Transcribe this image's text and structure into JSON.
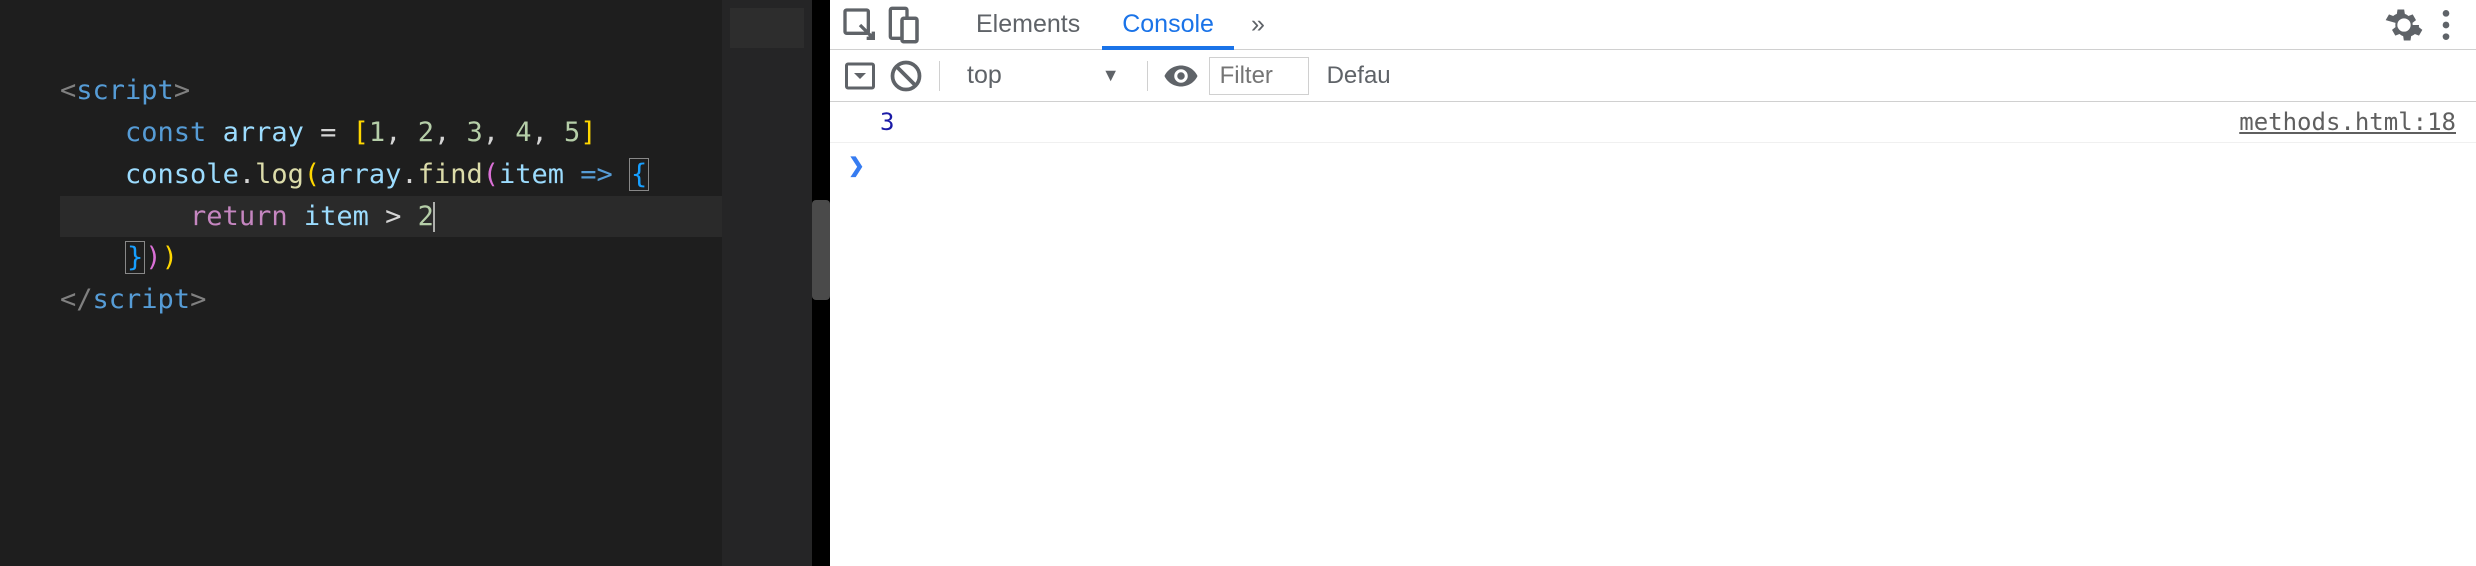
{
  "editor": {
    "code": {
      "line1_open_bracket": "<",
      "line1_tag": "script",
      "line1_close_bracket": ">",
      "line2_keyword": "const",
      "line2_var": "array",
      "line2_equals": " = ",
      "line2_bracket_open": "[",
      "line2_val1": "1",
      "line2_comma1": ", ",
      "line2_val2": "2",
      "line2_comma2": ", ",
      "line2_val3": "3",
      "line2_comma3": ", ",
      "line2_val4": "4",
      "line2_comma4": ", ",
      "line2_val5": "5",
      "line2_bracket_close": "]",
      "line3_obj": "console",
      "line3_dot1": ".",
      "line3_method1": "log",
      "line3_paren1": "(",
      "line3_var": "array",
      "line3_dot2": ".",
      "line3_method2": "find",
      "line3_paren2": "(",
      "line3_param": "item",
      "line3_arrow": " => ",
      "line3_brace": "{",
      "line4_keyword": "return",
      "line4_var": " item ",
      "line4_op": ">",
      "line4_val": " 2",
      "line5_brace": "}",
      "line5_paren1": ")",
      "line5_paren2": ")",
      "line6_open_bracket": "</",
      "line6_tag": "script",
      "line6_close_bracket": ">"
    }
  },
  "devtools": {
    "tabs": {
      "elements": "Elements",
      "console": "Console",
      "more": "»"
    },
    "toolbar": {
      "context": "top",
      "filter_placeholder": "Filter",
      "levels": "Defau"
    },
    "console": {
      "output_value": "3",
      "source_link": "methods.html:18",
      "prompt": "❯"
    }
  }
}
